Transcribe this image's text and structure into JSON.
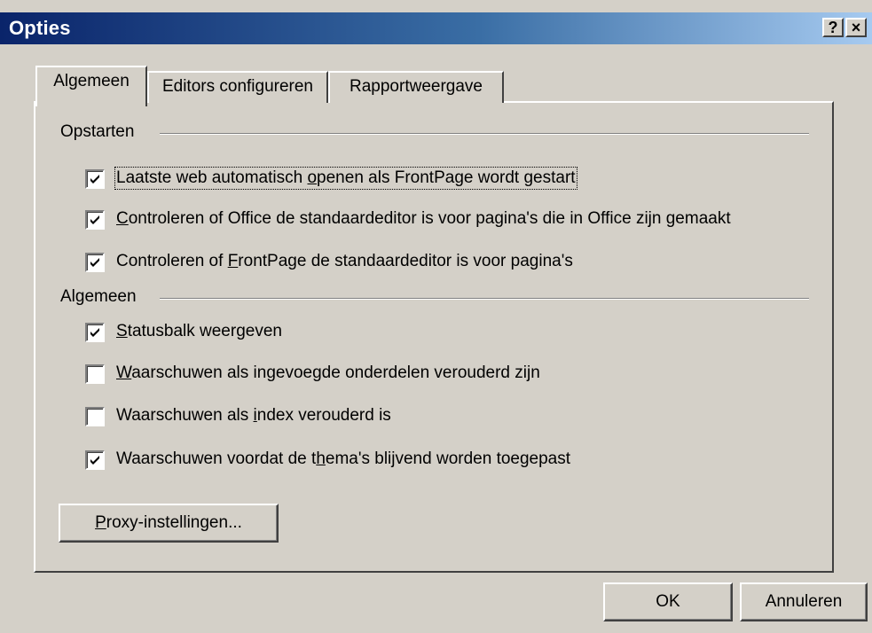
{
  "window": {
    "title": "Opties",
    "help_label": "?",
    "close_label": "×"
  },
  "tabs": [
    {
      "label": "Algemeen",
      "active": true
    },
    {
      "label": "Editors configureren",
      "active": false
    },
    {
      "label": "Rapportweergave",
      "active": false
    }
  ],
  "groups": {
    "startup": {
      "label": "Opstarten",
      "items": [
        {
          "pre": "Laatste web automatisch ",
          "acc": "o",
          "post": "penen als FrontPage wordt gestart",
          "checked": true
        },
        {
          "pre": "",
          "acc": "C",
          "post": "ontroleren of Office de standaardeditor is voor pagina's die in Office zijn gemaakt",
          "checked": true
        },
        {
          "pre": "Controleren of ",
          "acc": "F",
          "post": "rontPage de standaardeditor is voor pagina's",
          "checked": true
        }
      ]
    },
    "general": {
      "label": "Algemeen",
      "items": [
        {
          "pre": "",
          "acc": "S",
          "post": "tatusbalk weergeven",
          "checked": true
        },
        {
          "pre": "",
          "acc": "W",
          "post": "aarschuwen als ingevoegde onderdelen verouderd zijn",
          "checked": false
        },
        {
          "pre": "Waarschuwen als ",
          "acc": "i",
          "post": "ndex verouderd is",
          "checked": false
        },
        {
          "pre": "Waarschuwen voordat de t",
          "acc": "h",
          "post": "ema's blijvend worden toegepast",
          "checked": true
        }
      ]
    }
  },
  "buttons": {
    "proxy": {
      "acc": "P",
      "post": "roxy-instellingen..."
    },
    "ok": "OK",
    "cancel": "Annuleren"
  }
}
